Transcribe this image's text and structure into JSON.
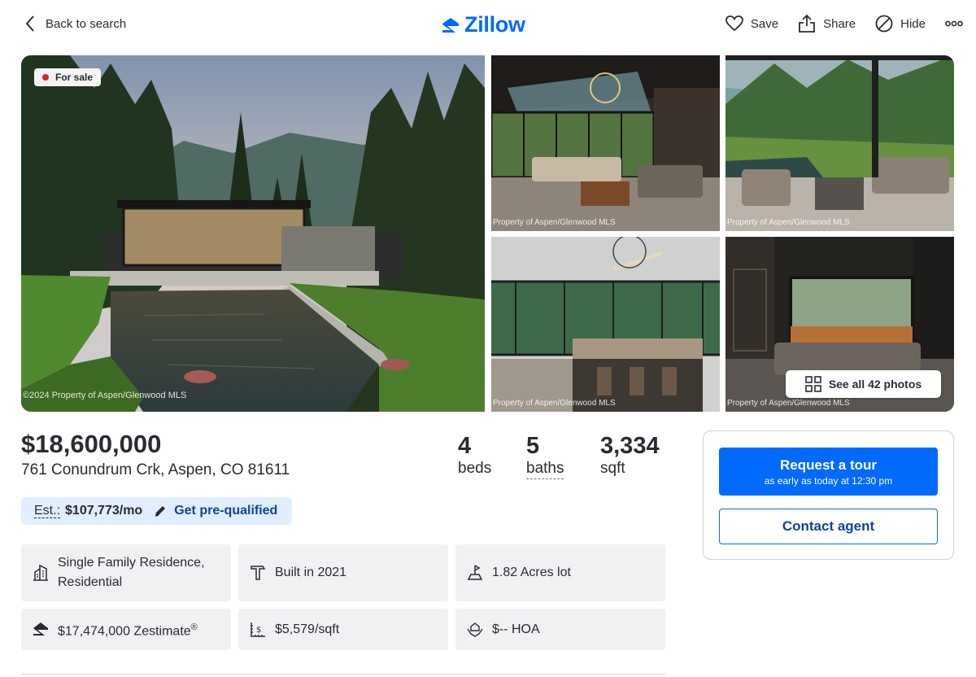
{
  "header": {
    "back_label": "Back to search",
    "logo_text": "Zillow",
    "actions": {
      "save": "Save",
      "share": "Share",
      "hide": "Hide"
    }
  },
  "photos": {
    "status_badge": "For sale",
    "hero_credit": "©2024 Property of Aspen/Glenwood MLS",
    "thumb_credit": "Property of Aspen/Glenwood MLS",
    "see_all_label": "See all 42 photos"
  },
  "listing": {
    "price": "$18,600,000",
    "address": "761 Conundrum Crk, Aspen, CO 81611",
    "beds_value": "4",
    "beds_label": "beds",
    "baths_value": "5",
    "baths_label": "baths",
    "sqft_value": "3,334",
    "sqft_label": "sqft"
  },
  "estimate": {
    "label": "Est.:",
    "value": "$107,773/mo",
    "prequal_label": "Get pre-qualified"
  },
  "facts": {
    "type_line1": "Single Family Residence,",
    "type_line2": "Residential",
    "built": "Built in 2021",
    "lot": "1.82 Acres lot",
    "zestimate": "$17,474,000 Zestimate",
    "zestimate_mark": "®",
    "price_per_sqft": "$5,579/sqft",
    "hoa": "$-- HOA"
  },
  "contact": {
    "tour_label": "Request a tour",
    "tour_sub": "as early as today at 12:30 pm",
    "agent_label": "Contact agent"
  },
  "colors": {
    "brand_blue": "#006aff",
    "dark_blue": "#0d4599",
    "status_red": "#d6212a",
    "pill_bg": "#e0eeff",
    "fact_bg": "#f1f1f4"
  },
  "icons": {
    "back": "chevron-left-icon",
    "save": "heart-icon",
    "share": "share-icon",
    "hide": "hide-icon",
    "more": "more-dots-icon",
    "grid": "grid-icon",
    "edit": "pencil-icon",
    "home_type": "building-icon",
    "built": "hammer-icon",
    "lot": "lot-icon",
    "zestimate": "zillow-icon",
    "price_sqft": "price-sqft-icon",
    "hoa": "hoa-hands-icon"
  }
}
